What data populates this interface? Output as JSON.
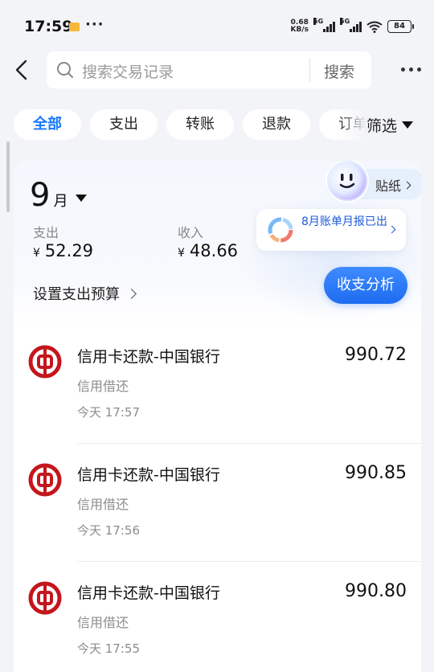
{
  "status_bar": {
    "time": "17:59",
    "net_speed": "0.68",
    "net_unit": "KB/s",
    "sig1_label": "5G",
    "sig2_label": "5G",
    "battery": "84"
  },
  "nav": {
    "search_placeholder": "搜索交易记录",
    "search_button": "搜索"
  },
  "filters": {
    "chips": [
      "全部",
      "支出",
      "转账",
      "退款",
      "订单"
    ],
    "active_index": 0,
    "filter_label": "筛选"
  },
  "summary": {
    "month_number": "9",
    "month_unit": "月",
    "expense_label": "支出",
    "expense_value": "52.29",
    "income_label": "收入",
    "income_value": "48.66",
    "currency": "¥",
    "budget_link": "设置支出预算",
    "sticker_label": "贴纸",
    "report_text": "8月账单月报已出",
    "analysis_button": "收支分析"
  },
  "transactions": [
    {
      "title": "信用卡还款-中国银行",
      "amount": "990.72",
      "category": "信用借还",
      "time": "今天 17:57"
    },
    {
      "title": "信用卡还款-中国银行",
      "amount": "990.85",
      "category": "信用借还",
      "time": "今天 17:56"
    },
    {
      "title": "信用卡还款-中国银行",
      "amount": "990.80",
      "category": "信用借还",
      "time": "今天 17:55"
    }
  ],
  "colors": {
    "accent": "#1677ff",
    "bank_red": "#c4161c",
    "background": "#f3f4f7"
  },
  "icons": {
    "back": "chevron-left-icon",
    "search": "search-icon",
    "more": "more-dots-icon",
    "bank": "bank-of-china-logo-icon"
  }
}
